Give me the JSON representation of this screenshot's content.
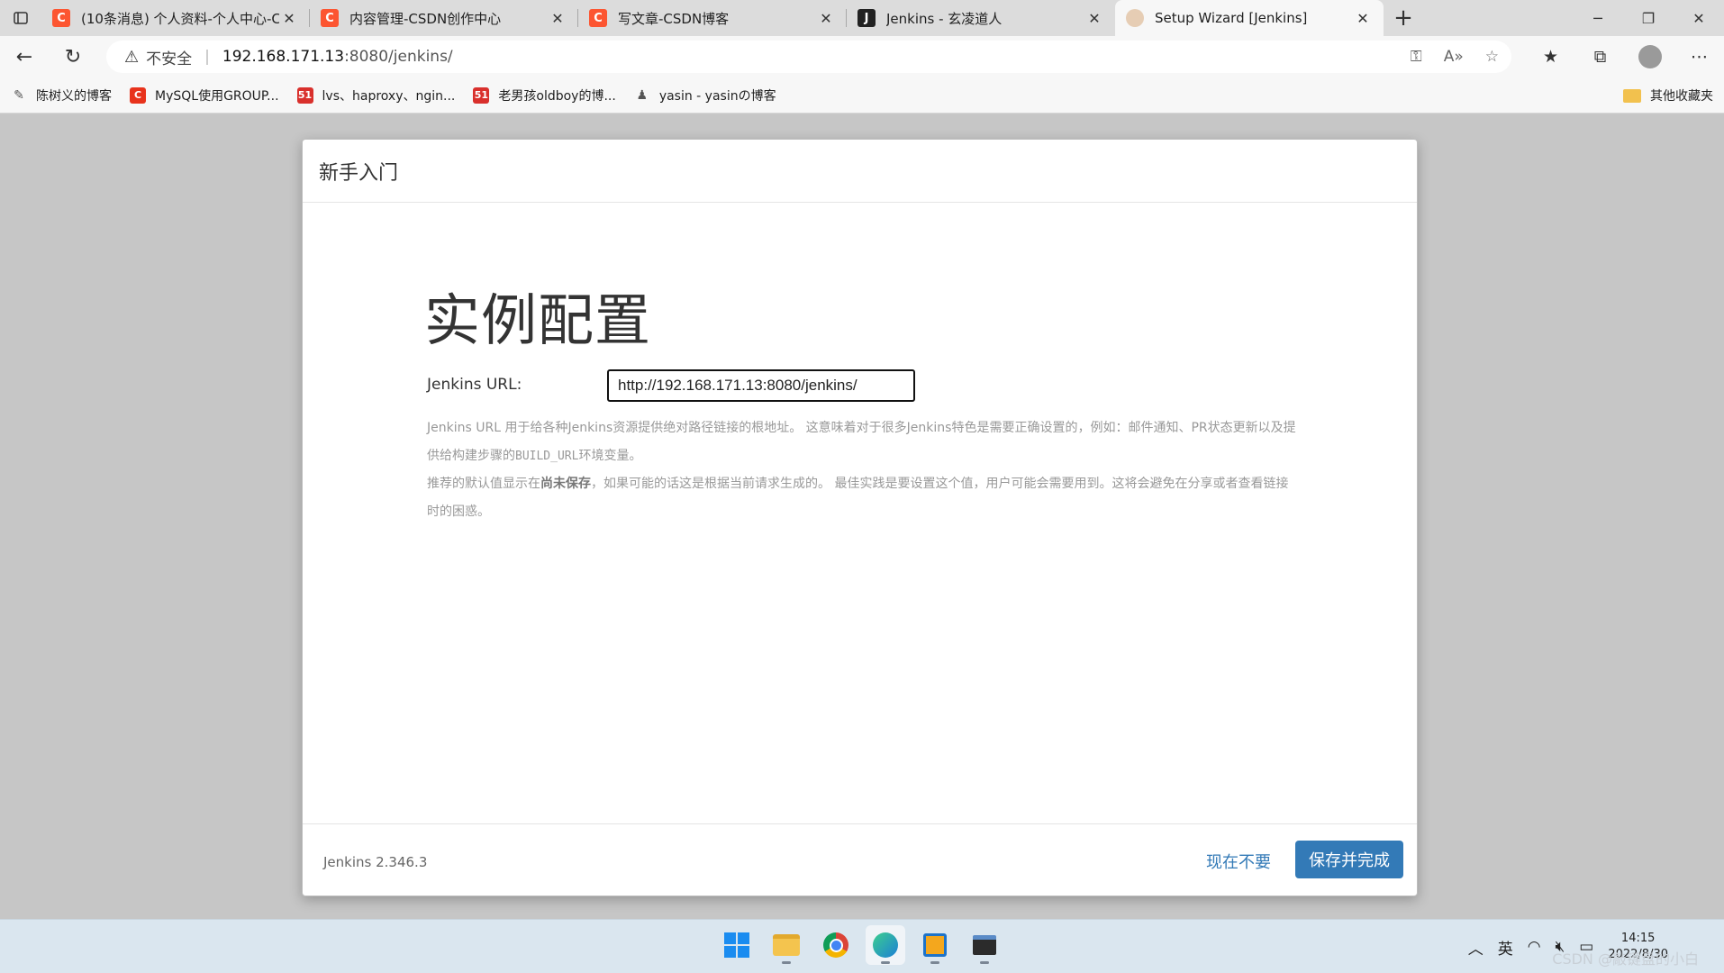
{
  "browser": {
    "tabs": [
      {
        "icon": "csdn-icon",
        "title": "(10条消息) 个人资料-个人中心-C",
        "active": false
      },
      {
        "icon": "csdn-icon",
        "title": "内容管理-CSDN创作中心",
        "active": false
      },
      {
        "icon": "csdn-icon",
        "title": "写文章-CSDN博客",
        "active": false
      },
      {
        "icon": "jenkins-icon",
        "title": "Jenkins - 玄凌道人",
        "active": false
      },
      {
        "icon": "jenkins-butler-icon",
        "title": "Setup Wizard [Jenkins]",
        "active": true
      }
    ],
    "address": {
      "security_label": "不安全",
      "host": "192.168.171.13",
      "path": ":8080/jenkins/"
    },
    "bookmarks": [
      {
        "icon": "blog-icon",
        "label": "陈树义的博客"
      },
      {
        "icon": "csdn-icon",
        "label": "MySQL使用GROUP..."
      },
      {
        "icon": "51cto-icon",
        "label": "lvs、haproxy、ngin..."
      },
      {
        "icon": "51cto-icon",
        "label": "老男孩oldboy的博..."
      },
      {
        "icon": "user-icon",
        "label": "yasin - yasinの博客"
      }
    ],
    "other_bookmarks": "其他收藏夹"
  },
  "dialog": {
    "header": "新手入门",
    "title": "实例配置",
    "url_label": "Jenkins URL:",
    "url_value": "http://192.168.171.13:8080/jenkins/",
    "help_p1_a": "Jenkins URL 用于给各种Jenkins资源提供绝对路径链接的根地址。 这意味着对于很多Jenkins特色是需要正确设置的，例如：邮件通知、PR状态更新以及提供给构建步骤的",
    "help_p1_code": "BUILD_URL",
    "help_p1_b": "环境变量。",
    "help_p2_a": "推荐的默认值显示在",
    "help_p2_bold": "尚未保存",
    "help_p2_b": "，如果可能的话这是根据当前请求生成的。 最佳实践是要设置这个值，用户可能会需要用到。这将会避免在分享或者查看链接时的困惑。",
    "version": "Jenkins 2.346.3",
    "skip_label": "现在不要",
    "save_label": "保存并完成"
  },
  "taskbar": {
    "ime": "英",
    "time": "14:15",
    "date": "2022/8/30",
    "watermark": "CSDN @敲键盘的小白"
  },
  "colors": {
    "primary_button": "#337ab7",
    "csdn_brand": "#fc5531"
  }
}
